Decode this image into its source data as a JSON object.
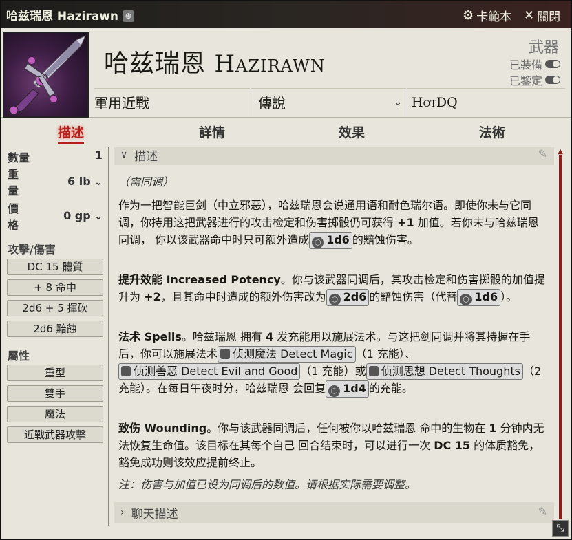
{
  "window": {
    "title": "哈兹瑞恩 Hazirawn",
    "sheet_label": "卡範本",
    "close_label": "關閉"
  },
  "header": {
    "name_cn": "哈兹瑞恩",
    "name_en": "Hazirawn",
    "item_type": "武器",
    "equipped_label": "已裝備",
    "identified_label": "已鑒定",
    "category": "軍用近戰",
    "rarity": "傳說",
    "source": "HotDQ"
  },
  "tabs": {
    "description": "描述",
    "details": "詳情",
    "effects": "效果",
    "spells": "法術"
  },
  "sidebar": {
    "quantity_label": "數量",
    "quantity_value": "1",
    "weight_label_1": "重",
    "weight_label_2": "量",
    "weight_value": "6 lb",
    "price_label_1": "價",
    "price_label_2": "格",
    "price_value": "0 gp",
    "attack_section": "攻擊/傷害",
    "attack_pills": [
      "DC 15 體質",
      "+ 8 命中",
      "2d6 + 5 揮砍",
      "2d6 黯蝕"
    ],
    "properties_section": "屬性",
    "property_pills": [
      "重型",
      "雙手",
      "魔法",
      "近戰武器攻擊"
    ]
  },
  "content": {
    "desc_header": "描述",
    "attunement": "（需同调）",
    "p1": {
      "text": "作为一把智能巨剑（中立邪恶），哈兹瑞恩会说通用语和耐色瑞尔语。即使你未与它同调，你持用这把武器进行的攻击检定和伤害掷骰仍可获得",
      "bonus": "+1",
      "text2": "加值。若你未与哈兹瑞恩同调， 你以该武器命中时只可额外造成",
      "dice": "1d6",
      "text3": "的黯蚀伤害。"
    },
    "p2": {
      "title": "提升效能 Increased Potency",
      "text": "。你与该武器同调后，其攻击检定和伤害掷骰的加值提升为",
      "bonus": "+2",
      "text2": "，且其命中时造成的额外伤害改为",
      "dice1": "2d6",
      "text3": "的黯蚀伤害（代替",
      "dice2": "1d6",
      "text4": "）。"
    },
    "p3": {
      "title": "法术 Spells",
      "text": "。哈兹瑞恩 拥有",
      "charges": "4",
      "text2": "发充能用以施展法术。与这把剑同调并将其持握在手后，你可以施展法术",
      "spell1": "侦测魔法 Detect Magic",
      "text3": "（1 充能）、",
      "spell2": "侦测善恶 Detect Evil and Good",
      "text4": "（1 充能）或",
      "spell3": "侦测思想 Detect Thoughts",
      "text5": "（2 充能）。在每日午夜时分，哈兹瑞恩 会回复",
      "dice": "1d4",
      "text6": "的充能。"
    },
    "p4": {
      "title": "致伤 Wounding",
      "text": "。你与该武器同调后，任何被你以哈兹瑞恩 命中的生物在",
      "num": "1",
      "text2": "分钟内无法恢复生命值。该目标在其每个自己 回合结束时，可以进行一次",
      "dc": "DC 15",
      "text3": "的体质豁免，豁免成功则该效应提前终止。"
    },
    "note": "注：伤害与加值已设为同调后的数值。请根据实际需要调整。",
    "chat_header": "聊天描述"
  },
  "colors": {
    "accent": "#b5201c",
    "background": "#e8e6dc",
    "scrollbar": "#8a1e1a"
  }
}
